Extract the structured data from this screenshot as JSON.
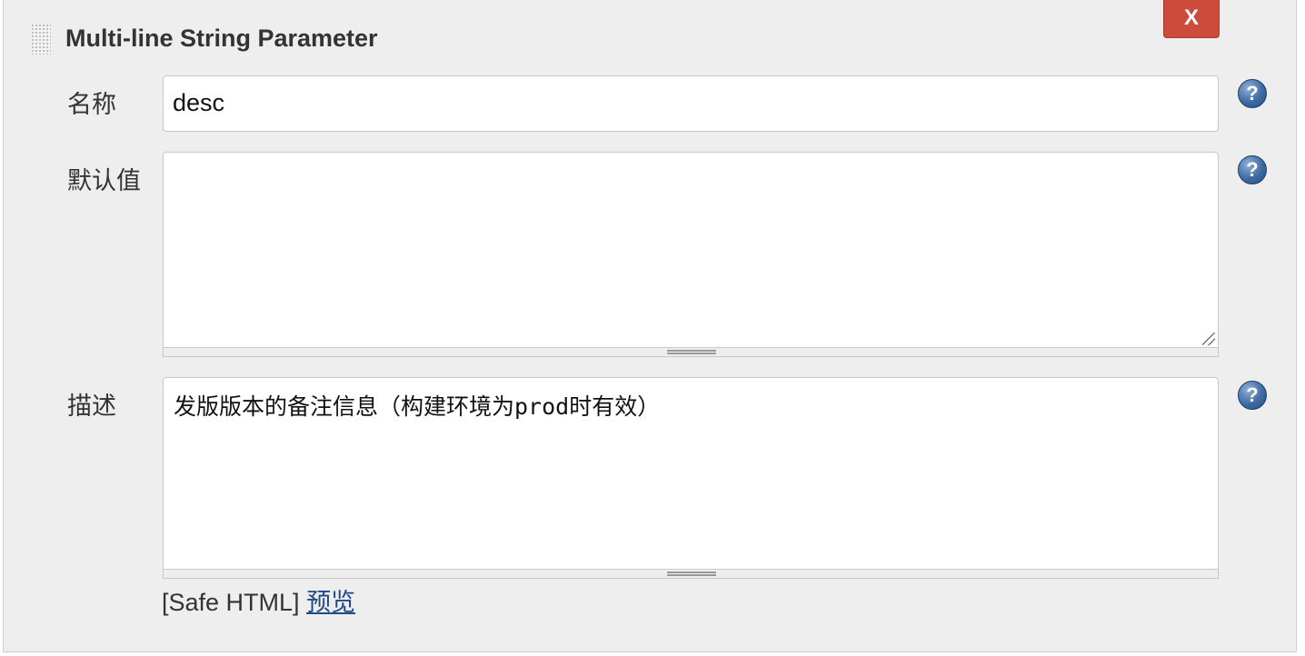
{
  "header": {
    "title": "Multi-line String Parameter",
    "close_label": "X"
  },
  "fields": {
    "name": {
      "label": "名称",
      "value": "desc"
    },
    "default": {
      "label": "默认值",
      "value": ""
    },
    "description": {
      "label": "描述",
      "value": "发版版本的备注信息（构建环境为prod时有效）"
    }
  },
  "help_icon_glyph": "?",
  "footer": {
    "safe_html_label": "[Safe HTML]",
    "preview_link": "预览"
  },
  "icons": {
    "drag": "drag-handle-icon",
    "help": "question-mark-icon",
    "close": "close-icon"
  },
  "colors": {
    "panel_bg": "#eeeeee",
    "close_button": "#cc4b3a",
    "help_icon": "#3e6aa3",
    "link": "#204a87"
  }
}
